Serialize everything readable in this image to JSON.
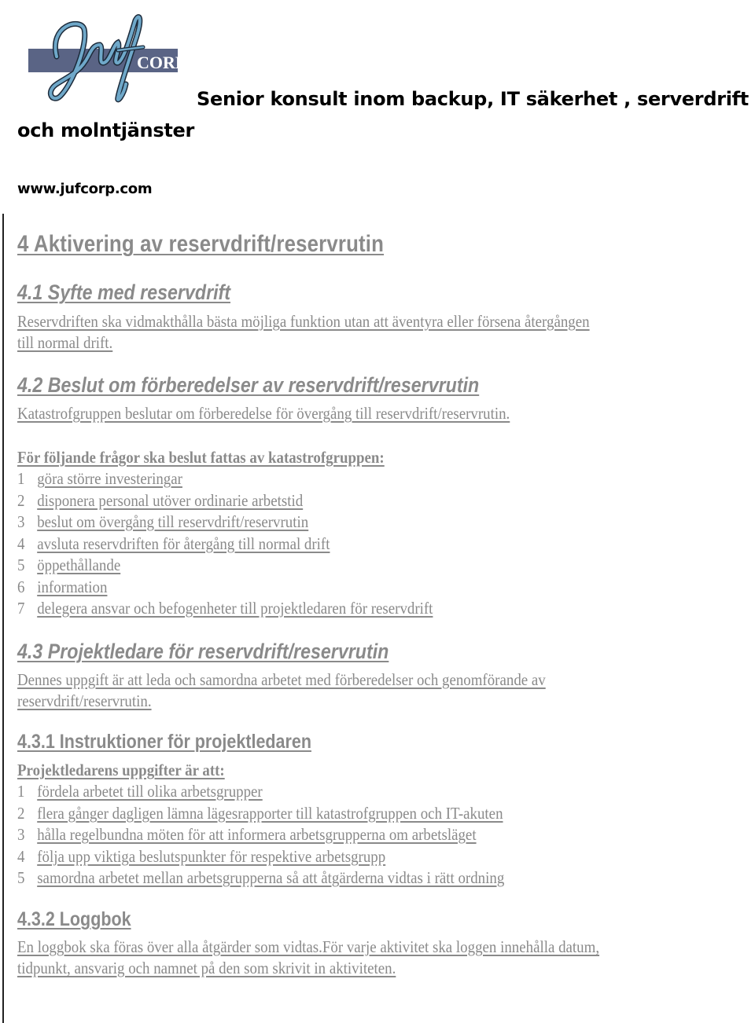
{
  "header": {
    "logo": {
      "script_text": "Juf",
      "badge_text": "CORP.",
      "bar_color": "#5a6485",
      "script_color": "#6fa8c9"
    },
    "tagline_line1": "Senior konsult inom backup, IT säkerhet , serverdrift",
    "tagline_line2": "och molntjänster",
    "website": "www.jufcorp.com"
  },
  "document": {
    "text_color": "#8a8a8a",
    "section4": {
      "title": "4   Aktivering av reservdrift/reservrutin"
    },
    "section4_1": {
      "title": "4.1  Syfte med reservdrift",
      "body_line1": "Reservdriften ska vidmakthålla bästa möjliga funktion utan att äventyra eller försena återgången ",
      "body_line2": "till normal drift."
    },
    "section4_2": {
      "title": "4.2  Beslut om förberedelser av reservdrift/reservrutin",
      "body": "Katastrofgruppen beslutar om förberedelse för övergång till reservdrift/reservrutin.",
      "list_lead": "För följande frågor ska beslut fattas av katastrofgruppen:",
      "items": [
        {
          "num": "1",
          "text": "göra större investeringar"
        },
        {
          "num": "2",
          "text": "disponera personal utöver ordinarie arbetstid "
        },
        {
          "num": "3",
          "text": "beslut om övergång till reservdrift/reservrutin"
        },
        {
          "num": "4",
          "text": "avsluta reservdriften för återgång till normal drift"
        },
        {
          "num": "5",
          "text": "öppethållande"
        },
        {
          "num": "6",
          "text": "information"
        },
        {
          "num": "7",
          "text": "delegera ansvar och befogenheter till projektledaren för reservdrift"
        }
      ]
    },
    "section4_3": {
      "title": "4.3  Projektledare för reservdrift/reservrutin",
      "body_line1": "Dennes uppgift är att leda och samordna arbetet med förberedelser och genomförande av ",
      "body_line2": "reservdrift/reservrutin."
    },
    "section4_3_1": {
      "title": "4.3.1  Instruktioner för projektledaren",
      "list_lead": "Projektledarens uppgifter är att:",
      "items": [
        {
          "num": "1",
          "text": "fördela arbetet till olika arbetsgrupper"
        },
        {
          "num": "2",
          "text": "flera gånger dagligen lämna lägesrapporter till katastrofgruppen och IT-akuten"
        },
        {
          "num": "3",
          "text": "hålla regelbundna möten för att informera arbetsgrupperna om arbetsläget"
        },
        {
          "num": "4",
          "text": "följa upp viktiga beslutspunkter för respektive arbetsgrupp"
        },
        {
          "num": "5",
          "text": "samordna arbetet mellan arbetsgrupperna så att åtgärderna vidtas i rätt ordning"
        }
      ]
    },
    "section4_3_2": {
      "title": "4.3.2  Loggbok",
      "body_line1": "En loggbok ska föras över alla åtgärder som vidtas.För varje aktivitet ska loggen innehålla datum,",
      "body_line2": "tidpunkt, ansvarig och namnet på den som skrivit in aktiviteten."
    }
  }
}
